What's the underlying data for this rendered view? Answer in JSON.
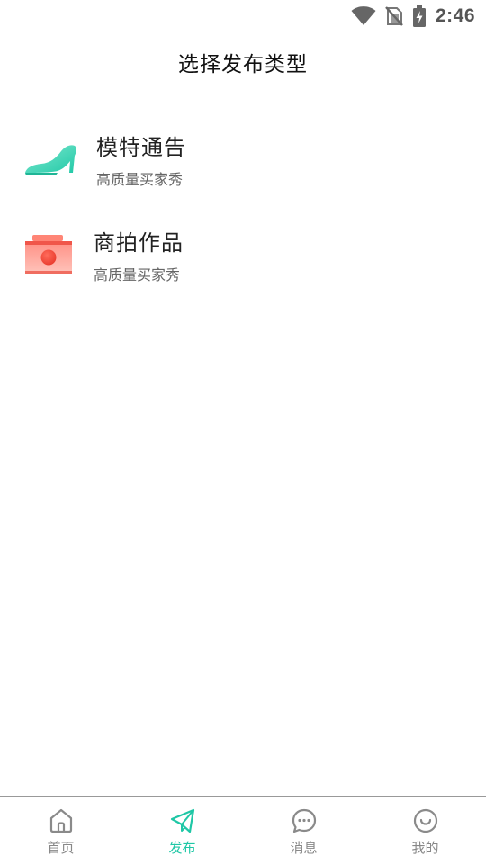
{
  "status_bar": {
    "time": "2:46",
    "icons": [
      "wifi-icon",
      "no-sim-icon",
      "battery-charging-icon"
    ]
  },
  "page": {
    "title": "选择发布类型"
  },
  "options": [
    {
      "title": "模特通告",
      "subtitle": "高质量买家秀",
      "icon": "high-heel-icon",
      "icon_color": "#2fd5b3"
    },
    {
      "title": "商拍作品",
      "subtitle": "高质量买家秀",
      "icon": "camera-box-icon",
      "icon_color": "#f45a4c"
    }
  ],
  "bottom_nav": {
    "active_color": "#1fc7a6",
    "inactive_color": "#888888",
    "items": [
      {
        "label": "首页",
        "icon": "home-icon",
        "active": false
      },
      {
        "label": "发布",
        "icon": "paper-plane-icon",
        "active": true
      },
      {
        "label": "消息",
        "icon": "chat-bubble-icon",
        "active": false
      },
      {
        "label": "我的",
        "icon": "smile-face-icon",
        "active": false
      }
    ]
  }
}
